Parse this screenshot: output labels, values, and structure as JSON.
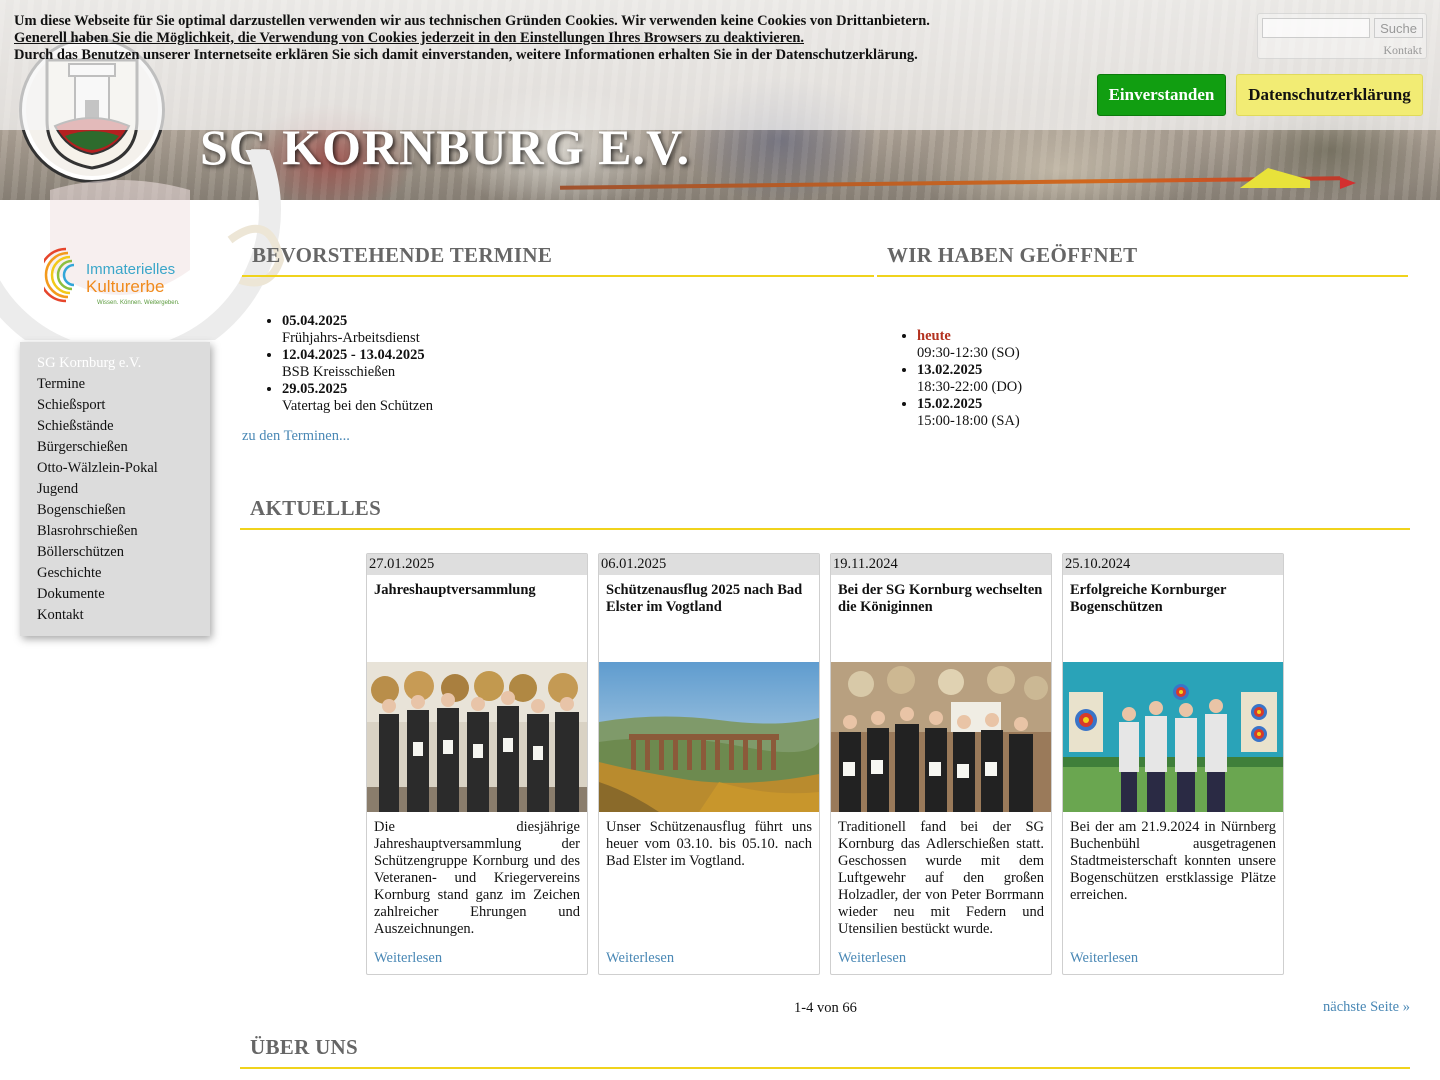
{
  "cookie_notice": {
    "line1": "Um diese Webseite für Sie optimal darzustellen verwenden wir aus technischen Gründen Cookies. Wir verwenden keine Cookies von Drittanbietern.",
    "line2": "Generell haben Sie die Möglichkeit, die Verwendung von Cookies jederzeit in den Einstellungen Ihres Browsers zu deaktivieren.",
    "line3": "Durch das Benutzen unserer Internetseite erklären Sie sich damit einverstanden, weitere Informationen erhalten Sie in der Datenschutzerklärung.",
    "accept_label": "Einverstanden",
    "privacy_label": "Datenschutzerklärung",
    "accent_green": "#119e11",
    "accent_yellow": "#f2ec74"
  },
  "search": {
    "placeholder": "",
    "button_label": "Suche",
    "contact_label": "Kontakt"
  },
  "header": {
    "site_title": "SG KORNBURG E.V."
  },
  "sidebar": {
    "logo_line1": "Immaterielles",
    "logo_line2": "Kulturerbe",
    "logo_tagline": "Wissen. Können. Weitergeben.",
    "items": [
      {
        "label": "SG Kornburg e.V."
      },
      {
        "label": "Termine"
      },
      {
        "label": "Schießsport"
      },
      {
        "label": "Schießstände"
      },
      {
        "label": "Bürgerschießen"
      },
      {
        "label": "Otto-Wälzlein-Pokal"
      },
      {
        "label": "Jugend"
      },
      {
        "label": "Bogenschießen"
      },
      {
        "label": "Blasrohrschießen"
      },
      {
        "label": "Böllerschützen"
      },
      {
        "label": "Geschichte"
      },
      {
        "label": "Dokumente"
      },
      {
        "label": "Kontakt"
      }
    ]
  },
  "events": {
    "heading": "BEVORSTEHENDE TERMINE",
    "items": [
      {
        "date": "05.04.2025",
        "title": "Frühjahrs-Arbeitsdienst"
      },
      {
        "date": "12.04.2025 - 13.04.2025",
        "title": "BSB Kreisschießen"
      },
      {
        "date": "29.05.2025",
        "title": "Vatertag bei den Schützen"
      }
    ],
    "more_link": "zu den Terminen..."
  },
  "opening": {
    "heading": "WIR HABEN GEÖFFNET",
    "items": [
      {
        "day": "heute",
        "time": "09:30-12:30 (SO)"
      },
      {
        "day": "13.02.2025",
        "time": "18:30-22:00 (DO)"
      },
      {
        "day": "15.02.2025",
        "time": "15:00-18:00 (SA)"
      }
    ]
  },
  "news": {
    "heading": "AKTUELLES",
    "cards": [
      {
        "date": "27.01.2025",
        "title": "Jahreshauptversammlung",
        "text": "Die diesjährige Jahreshauptversammlung der Schützengruppe Kornburg und des Veteranen- und Kriegervereins Kornburg stand ganz im Zeichen zahlreicher Ehrungen und Auszeichnungen.",
        "more": "Weiterlesen"
      },
      {
        "date": "06.01.2025",
        "title": "Schützenausflug 2025 nach Bad Elster im Vogtland",
        "text": "Unser Schützenausflug führt uns heuer vom 03.10. bis 05.10. nach Bad Elster im Vogtland.",
        "more": "Weiterlesen"
      },
      {
        "date": "19.11.2024",
        "title": "Bei der SG Kornburg wechselten die Königinnen",
        "text": "Traditionell fand bei der SG Kornburg das Adlerschießen statt. Geschossen wurde mit dem Luftgewehr auf den großen Holzadler, der von Peter Borrmann wieder neu mit Federn und Utensilien bestückt wurde.",
        "more": "Weiterlesen"
      },
      {
        "date": "25.10.2024",
        "title": "Erfolgreiche Kornburger Bogenschützen",
        "text": "Bei der am 21.9.2024 in Nürnberg Buchenbühl ausgetragenen Stadtmeisterschaft konnten unsere Bogenschützen erstklassige Plätze erreichen.",
        "more": "Weiterlesen"
      }
    ],
    "pager": "1-4 von 66",
    "next_label": "nächste Seite »"
  },
  "about": {
    "heading": "ÜBER UNS"
  },
  "colors": {
    "heading_underline": "#f0d31c",
    "link": "#4a88b5",
    "today": "#b3311f"
  }
}
